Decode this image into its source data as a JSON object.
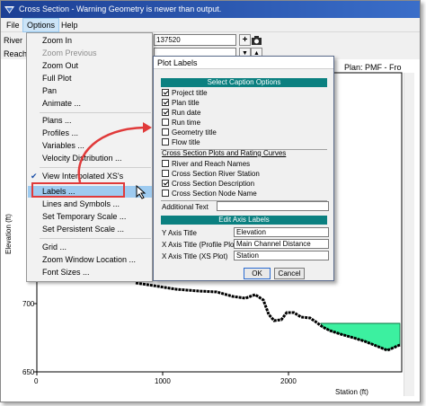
{
  "window": {
    "title": "Cross Section - Warning Geometry is newer than output."
  },
  "menubar": {
    "items": [
      "File",
      "Options",
      "Help"
    ]
  },
  "toolbar": {
    "river_label": "River",
    "reach_label": "Reach",
    "river_station_value": "137520",
    "add_button": "+",
    "up_button": "▲",
    "down_button": "▼"
  },
  "plot": {
    "plan_title": "Plan: PMF - Fro",
    "y_axis_label": "Elevation (ft)",
    "x_axis_label": "Station (ft)",
    "y_ticks": [
      "700",
      "650"
    ],
    "x_ticks": [
      "0",
      "1000",
      "2000"
    ]
  },
  "options_menu": {
    "items": [
      {
        "label": "Zoom In",
        "disabled": false
      },
      {
        "label": "Zoom Previous",
        "disabled": true
      },
      {
        "label": "Zoom Out",
        "disabled": false
      },
      {
        "label": "Full Plot",
        "disabled": false
      },
      {
        "label": "Pan",
        "disabled": false
      },
      {
        "label": "Animate ...",
        "disabled": false
      },
      {
        "label": "Plans ...",
        "disabled": false
      },
      {
        "label": "Profiles ...",
        "disabled": false
      },
      {
        "label": "Variables ...",
        "disabled": false
      },
      {
        "label": "Velocity Distribution ...",
        "disabled": false
      },
      {
        "label": "View Interpolated XS's",
        "disabled": false,
        "checked": true
      },
      {
        "label": "Labels ...",
        "disabled": false,
        "highlighted": true
      },
      {
        "label": "Lines and Symbols ...",
        "disabled": false
      },
      {
        "label": "Set Temporary Scale ...",
        "disabled": false
      },
      {
        "label": "Set Persistent Scale ...",
        "disabled": false
      },
      {
        "label": "Grid ...",
        "disabled": false
      },
      {
        "label": "Zoom Window Location ...",
        "disabled": false
      },
      {
        "label": "Font Sizes ...",
        "disabled": false
      }
    ]
  },
  "dialog": {
    "title": "Plot Labels",
    "caption_header": "Select Caption Options",
    "caption_options": [
      {
        "label": "Project title",
        "checked": true
      },
      {
        "label": "Plan title",
        "checked": true
      },
      {
        "label": "Run date",
        "checked": true
      },
      {
        "label": "Run time",
        "checked": false
      },
      {
        "label": "Geometry title",
        "checked": false
      },
      {
        "label": "Flow title",
        "checked": false
      }
    ],
    "subheader": "Cross Section Plots and Rating Curves",
    "xs_options": [
      {
        "label": "River and Reach Names",
        "checked": false
      },
      {
        "label": "Cross Section River Station",
        "checked": false
      },
      {
        "label": "Cross Section Description",
        "checked": true
      },
      {
        "label": "Cross Section Node Name",
        "checked": false
      }
    ],
    "additional_text_label": "Additional Text",
    "additional_text_value": "",
    "axis_header": "Edit Axis Labels",
    "y_axis_title_label": "Y Axis Title",
    "y_axis_title_value": "Elevation",
    "x_axis_profile_label": "X Axis Title (Profile Plot)",
    "x_axis_profile_value": "Main Channel Distance",
    "x_axis_xs_label": "X Axis Title (XS Plot)",
    "x_axis_xs_value": "Station",
    "ok_label": "OK",
    "cancel_label": "Cancel"
  },
  "colors": {
    "titlebar": "#1c3f94",
    "section_header": "#0b8080",
    "highlight": "#9ecbf0",
    "callout": "#e03a3a",
    "water": "#3cf0a0"
  }
}
